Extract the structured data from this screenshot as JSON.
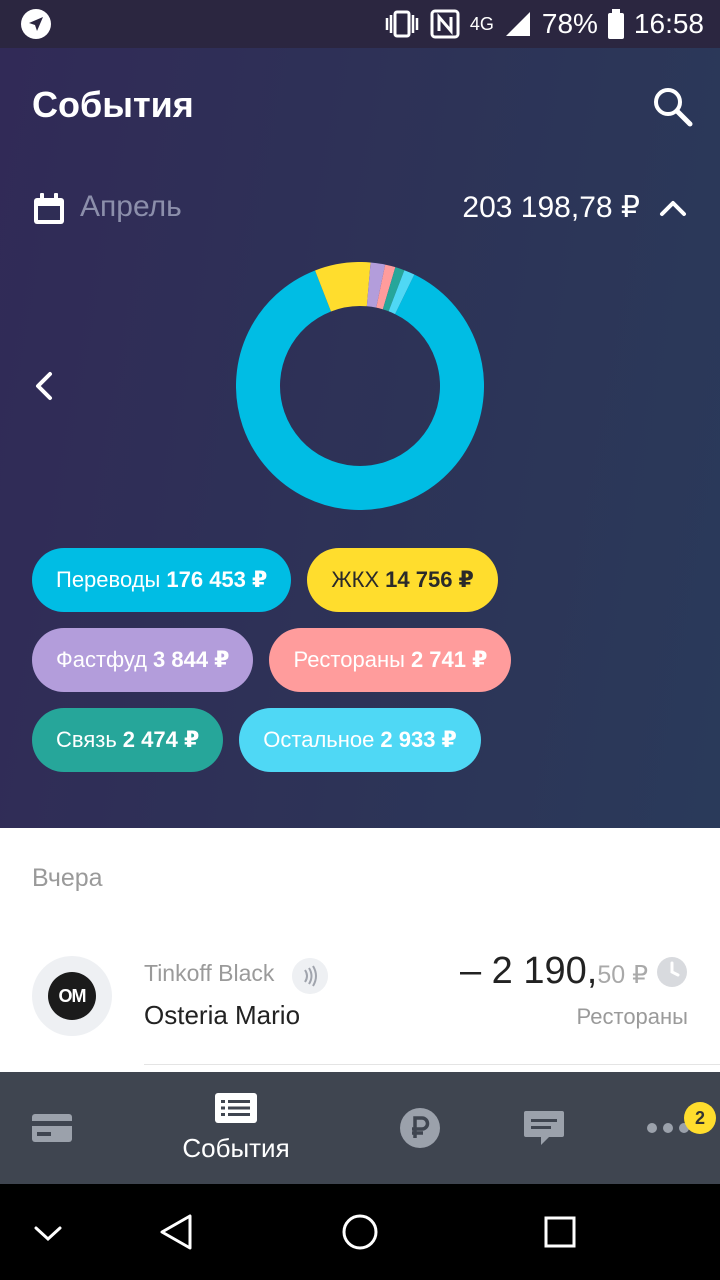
{
  "status_bar": {
    "battery": "78%",
    "time": "16:58",
    "network": "4G"
  },
  "header": {
    "title": "События",
    "search_icon": "search-icon"
  },
  "period": {
    "month": "Апрель",
    "total": "203 198,78 ₽"
  },
  "chart_data": {
    "type": "pie",
    "donut": true,
    "slices": [
      {
        "label": "Переводы",
        "value": 176453,
        "color": "#00bde4"
      },
      {
        "label": "ЖКХ",
        "value": 14756,
        "color": "#ffdd2d"
      },
      {
        "label": "Фастфуд",
        "value": 3844,
        "color": "#b39ddb"
      },
      {
        "label": "Рестораны",
        "value": 2741,
        "color": "#ff9c9c"
      },
      {
        "label": "Связь",
        "value": 2474,
        "color": "#26a69a"
      },
      {
        "label": "Остальное",
        "value": 2933,
        "color": "#4fd8f5"
      }
    ]
  },
  "categories": [
    {
      "name": "Переводы",
      "amount": "176 453 ₽",
      "color": "#00bde4",
      "text_dark": false
    },
    {
      "name": "ЖКХ",
      "amount": "14 756 ₽",
      "color": "#ffdd2d",
      "text_dark": true
    },
    {
      "name": "Фастфуд",
      "amount": "3 844 ₽",
      "color": "#b39ddb",
      "text_dark": false
    },
    {
      "name": "Рестораны",
      "amount": "2 741 ₽",
      "color": "#ff9c9c",
      "text_dark": false
    },
    {
      "name": "Связь",
      "amount": "2 474 ₽",
      "color": "#26a69a",
      "text_dark": false
    },
    {
      "name": "Остальное",
      "amount": "2 933 ₽",
      "color": "#4fd8f5",
      "text_dark": false
    }
  ],
  "feed": {
    "day_label": "Вчера",
    "transactions": [
      {
        "card": "Tinkoff Black",
        "merchant": "Osteria Mario",
        "logo_text": "OM",
        "amount_main": "– 2 190,",
        "amount_cents": "50 ₽",
        "category": "Рестораны"
      }
    ]
  },
  "bottom_nav": {
    "items": [
      {
        "icon": "card-icon",
        "label": ""
      },
      {
        "icon": "list-icon",
        "label": "События"
      },
      {
        "icon": "ruble-icon",
        "label": ""
      },
      {
        "icon": "chat-icon",
        "label": ""
      },
      {
        "icon": "more-icon",
        "label": ""
      }
    ],
    "badge": "2"
  }
}
